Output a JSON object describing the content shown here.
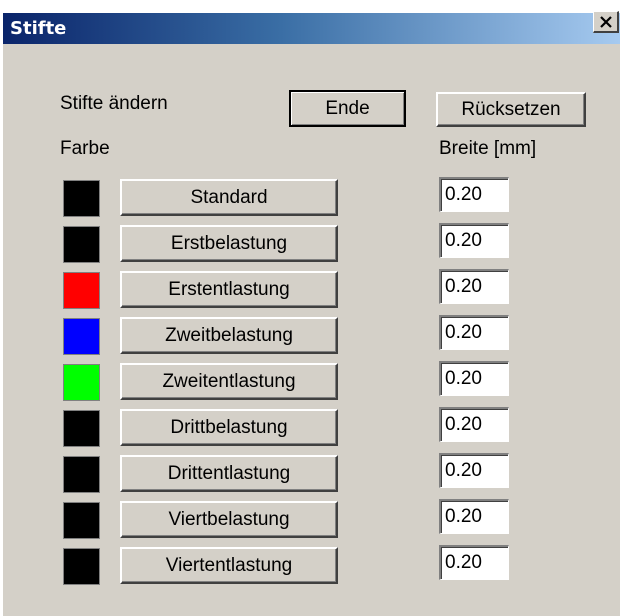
{
  "window": {
    "title": "Stifte"
  },
  "header": {
    "change_label": "Stifte ändern",
    "color_label": "Farbe",
    "width_label": "Breite [mm]",
    "end_button": "Ende",
    "reset_button": "Rücksetzen"
  },
  "pens": [
    {
      "name": "Standard",
      "color": "#000000",
      "width": "0.20"
    },
    {
      "name": "Erstbelastung",
      "color": "#000000",
      "width": "0.20"
    },
    {
      "name": "Erstentlastung",
      "color": "#ff0000",
      "width": "0.20"
    },
    {
      "name": "Zweitbelastung",
      "color": "#0000ff",
      "width": "0.20"
    },
    {
      "name": "Zweitentlastung",
      "color": "#00ff00",
      "width": "0.20"
    },
    {
      "name": "Drittbelastung",
      "color": "#000000",
      "width": "0.20"
    },
    {
      "name": "Drittentlastung",
      "color": "#000000",
      "width": "0.20"
    },
    {
      "name": "Viertbelastung",
      "color": "#000000",
      "width": "0.20"
    },
    {
      "name": "Viertentlastung",
      "color": "#000000",
      "width": "0.20"
    }
  ]
}
